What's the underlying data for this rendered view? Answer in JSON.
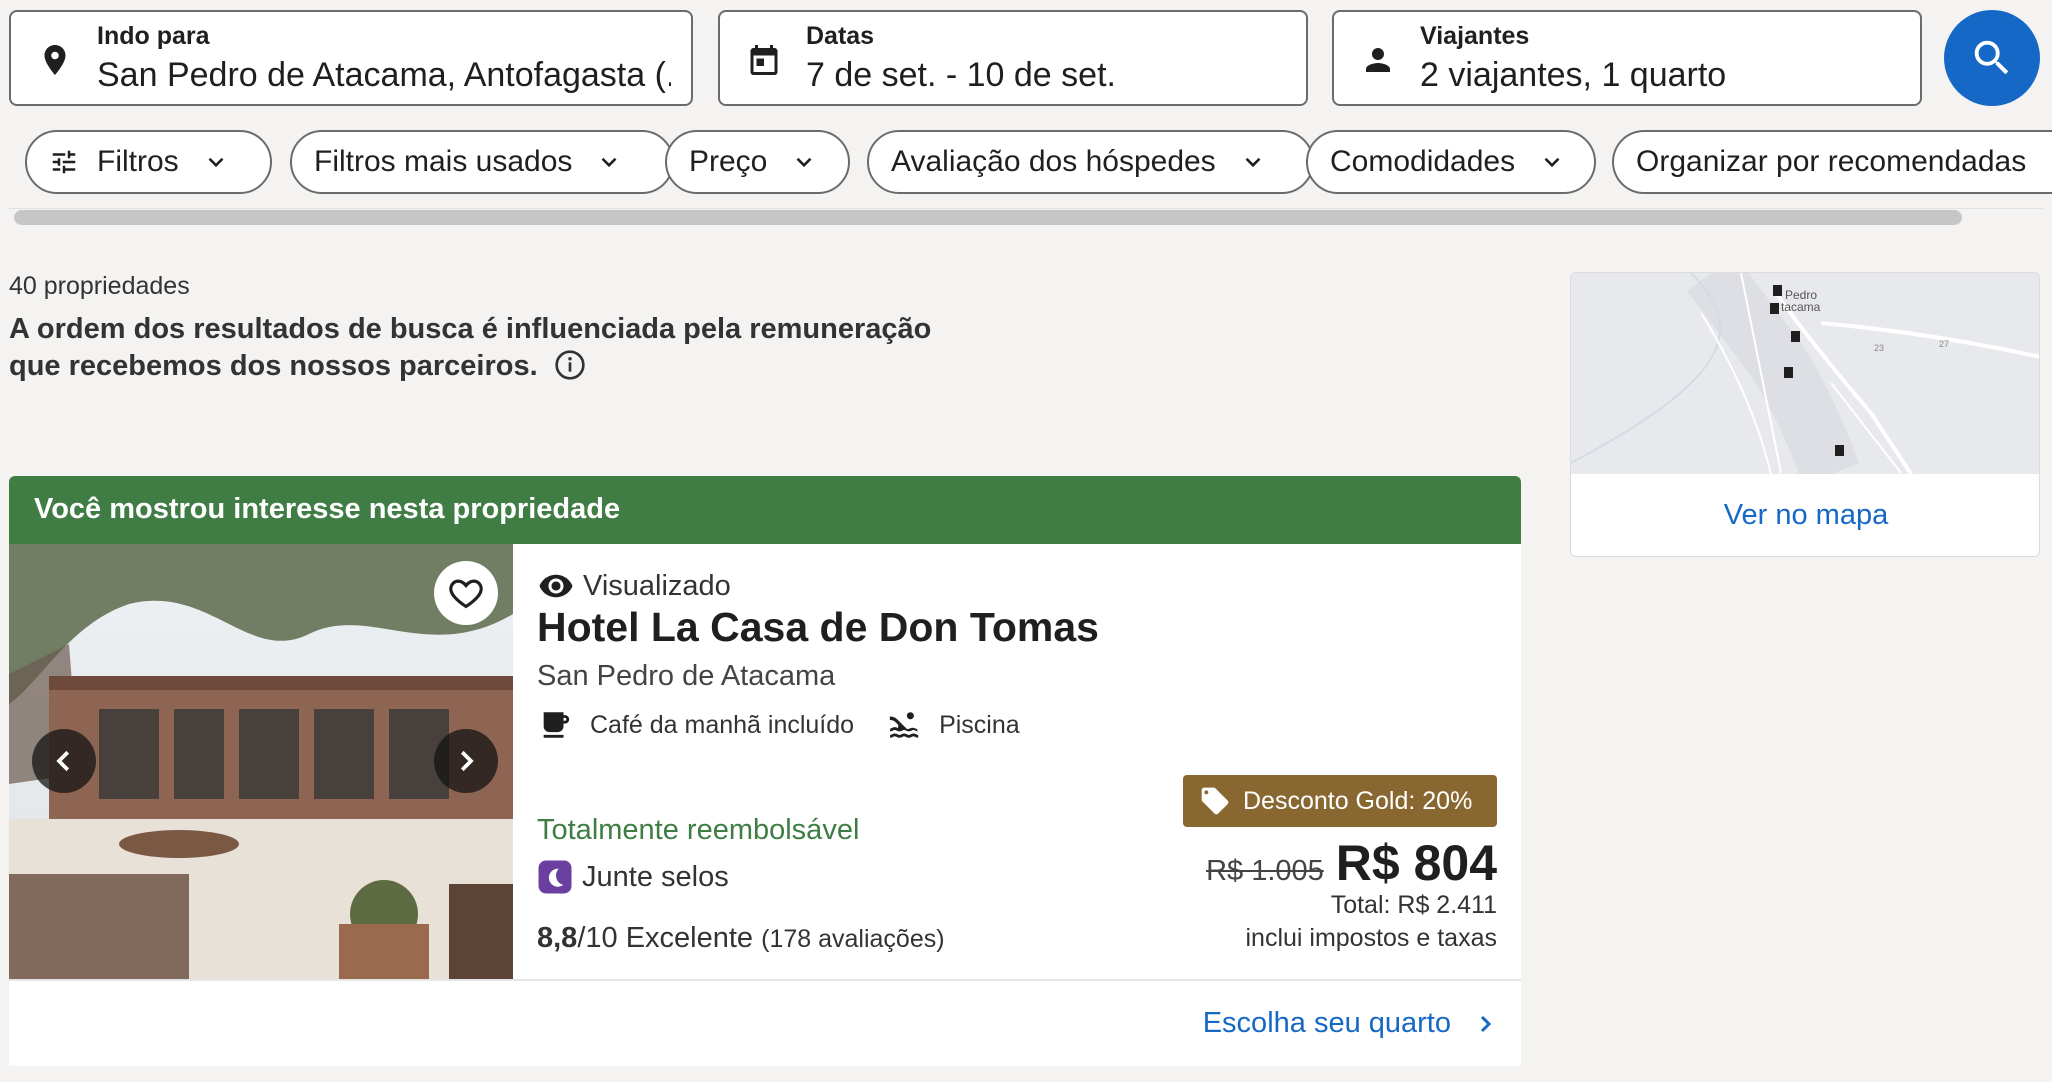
{
  "search": {
    "destination": {
      "label": "Indo para",
      "value": "San Pedro de Atacama, Antofagasta (...",
      "icon": "location-pin-icon"
    },
    "dates": {
      "label": "Datas",
      "value": "7 de set. - 10 de set.",
      "icon": "calendar-icon"
    },
    "travelers": {
      "label": "Viajantes",
      "value": "2 viajantes, 1 quarto",
      "icon": "person-icon"
    },
    "search_icon": "search-icon",
    "accent": "#1668c7"
  },
  "filters": [
    {
      "label": "Filtros",
      "icon": "sliders-icon"
    },
    {
      "label": "Filtros mais usados"
    },
    {
      "label": "Preço"
    },
    {
      "label": "Avaliação dos hóspedes"
    },
    {
      "label": "Comodidades"
    },
    {
      "label": "Organizar por recomendadas"
    }
  ],
  "results": {
    "count": "40 propriedades",
    "disclaimer": "A ordem dos resultados de busca é influenciada pela remuneração que recebemos dos nossos parceiros."
  },
  "map": {
    "link": "Ver no mapa",
    "place_label_1": "Pedro",
    "place_label_2": "tacama",
    "road_label": "23",
    "road_label_2": "27"
  },
  "property": {
    "banner": "Você mostrou interesse nesta propriedade",
    "banner_color": "#3f7d45",
    "viewed": "Visualizado",
    "name": "Hotel La Casa de Don Tomas",
    "location": "San Pedro de Atacama",
    "amenities": [
      {
        "label": "Café da manhã incluído",
        "icon": "coffee-cup-icon"
      },
      {
        "label": "Piscina",
        "icon": "pool-icon"
      }
    ],
    "refundable": "Totalmente reembolsável",
    "stamps": "Junte selos",
    "rating": {
      "score": "8,8",
      "out_of": "/10 Excelente",
      "reviews": "(178 avaliações)"
    },
    "discount_badge": "Desconto Gold: 20%",
    "discount_color": "#886830",
    "old_price": "R$ 1.005",
    "price": "R$ 804",
    "total": "Total: R$ 2.411",
    "taxes": "inclui impostos e taxas",
    "cta": "Escolha seu quarto"
  }
}
